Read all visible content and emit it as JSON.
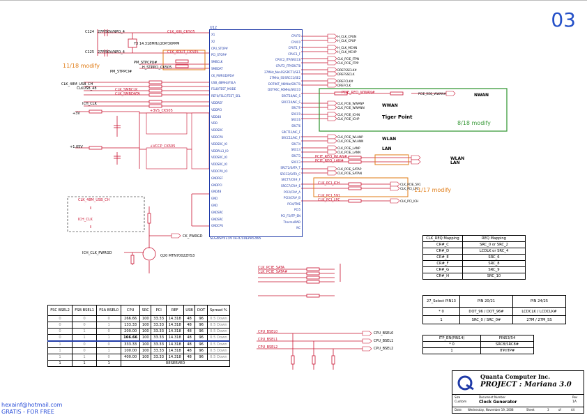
{
  "page": {
    "number": "03"
  },
  "chip": {
    "ref": "U12",
    "part": "SLG8SP513VTR-ICS9LPRS365",
    "left_pins": [
      "X1",
      "X2",
      "CPU_STOP#",
      "PCI_STOP#",
      "SMBCLK",
      "SMBDAT",
      "CK_PWRGD/PD#",
      "USB_48MHz/FSLA",
      "FSLB/TEST_MODE",
      "REF0/FSLC/TEST_SEL",
      "VDDREF",
      "VDDPCI",
      "VDD48",
      "VDD",
      "VDDSRC",
      "VDDCPU",
      "VDDSRC_IO",
      "VDDPLL3_IO",
      "VDDSRC_IO",
      "VDDSRC_IO",
      "VDDCPU_IO",
      "GNDREF",
      "GNDPCI",
      "GND48",
      "GND",
      "GND",
      "GNDSRC",
      "GNDSRC",
      "GNDCPU"
    ],
    "right_pins": [
      "CPUT0",
      "CPUC0",
      "CPUT1_F",
      "CPUC1_F",
      "CPUC2_ITP/SRCC8",
      "CPUT2_ITP/SRCT8",
      "27MHz_NonSS/SRCT1/SE1",
      "27MHz_SS/SRCC1/SE2",
      "DOT96T_96MHz/SRCT0",
      "DOT96C_96MHz/SRCC0",
      "SRCT10/NC_S",
      "SRCC10/NC_S",
      "SRCT9",
      "SRCC9",
      "SRCC6",
      "SRCT6",
      "SRCT11/NC_F",
      "SRCC11/NC_F",
      "SRCT4",
      "SRCC4",
      "SRCT3",
      "SRCC3",
      "SRCT2/SATA_T",
      "SRCC2/SATA_C",
      "SRCT7/CR#_F",
      "SRCC7/CR#_E",
      "PCI2/CR#_A",
      "PCI3/CR#_B",
      "PCI4/TME",
      "PCI5",
      "PCI_F5/ITP_EN",
      "ThermalPAD",
      "NC"
    ]
  },
  "labels": {
    "top_red": "CLK_XIN_CK505",
    "top_red2": "CLK_XOUT_CK505",
    "crystal": "Y3 14.318MHz/20P/30PPM",
    "c124": "C124",
    "c125": "C125",
    "cap_value": "27P/50V/NPO_4",
    "modify_1118": "11/18 modify",
    "modify_818": "8/18 modify",
    "modify_1117": "11/17 modify",
    "pm_stpcpu": "PM_STPCPU#",
    "pm_stppci": "PM_STPPCI#",
    "pm_stppci_r": "H_STPPCI_CK505",
    "clk_smb": "CLK_SMBCLK",
    "clk_smd": "CLK_SMBDATA",
    "vcore_ck505": "+3VS_CK505",
    "vcore_ck505_io": "+VCCP_CK505",
    "clk48": "CLK_48M_USB_CH",
    "clk48_usb": "CLKUSB_48",
    "ich": "ICH_CLK",
    "v3": "+3V",
    "v1": "+1.05V",
    "ck_pwrgd": "CK_PWRGD",
    "clk_en": "ICH_CLK_PWRGD",
    "q20": "Q20 MTN7002ZHS3",
    "tiger_point": "Tiger Point",
    "nwan": "NWAN",
    "wwan": "WWAN",
    "wlan": "WLAN",
    "lan": "LAN",
    "wlan_lan": "WLAN LAN",
    "pcie_req_nwan": "PCIE_REQ_WWAN#",
    "pcie_req_wlan": "PCIE_REQ_WLAN#",
    "pcie_req_lan": "PCIE_REQ_LAN#",
    "clk_pcie_sataa": "CLK_PCIE_SATA",
    "clk_pcie_sata_b": "CLK_PCIE_SATA#",
    "clk_pci_ich": "CLK_PCI_ICH",
    "clk_pci_591": "CLK_PCI_591",
    "clk_pci_lpc": "CLK_PCI_LPC",
    "net_cpu_bsel0": "CPU_BSEL0",
    "net_cpu_bsel1": "CPU_BSEL1",
    "net_cpu_bsel2": "CPU_BSEL2",
    "watermark_email": "hexainf@hotmail.com",
    "watermark_free": "GRATIS - FOR FREE"
  },
  "right_nets": [
    "H_CLK_CPUN",
    "H_CLK_CPUP",
    "H_CLK_MCHN",
    "H_CLK_MCHP",
    "CLK_PCIE_ITPN",
    "CLK_PCIE_ITPP",
    "DREFSSCLK#",
    "DREFSSCLK",
    "DREFCLK#",
    "DREFCLK",
    "PCIE_REQ_WWAN#",
    "CLK_PCIE_WWANP",
    "CLK_PCIE_WWANN",
    "CLK_PCIE_ICHN",
    "CLK_PCIE_ICHP",
    "CLK_PCIE_WLANP",
    "CLK_PCIE_WLANN",
    "CLK_PCIE_LANP",
    "CLK_PCIE_LANN",
    "CLK_PCIE_SATAP",
    "CLK_PCIE_SATAN",
    "CLK_PCIE_591",
    "CLK_PCI_LPC",
    "CLK_PCI_ICH"
  ],
  "clk_req_table": {
    "headers": [
      "CLK_REQ Mapping",
      "REQ Mapping"
    ],
    "rows": [
      [
        "CR#_C",
        "SRC_0 or SRC_2"
      ],
      [
        "CR#_D",
        "LCDLK or SRC_4"
      ],
      [
        "CR#_E",
        "SRC_6"
      ],
      [
        "CR#_F",
        "SRC_8"
      ],
      [
        "CR#_G",
        "SRC_9"
      ],
      [
        "CR#_H",
        "SRC_10"
      ]
    ]
  },
  "select_table": {
    "headers": [
      "27_Select PIN13",
      "PIN 20/21",
      "PIN 24/25"
    ],
    "rows": [
      [
        "*  0",
        "DOT_96 / DOT_96#",
        "LCDCLK / LCDCLK#"
      ],
      [
        "1",
        "SRC_0 / SRC_0#",
        "27M / 27M_SS"
      ]
    ]
  },
  "itp_table": {
    "headers": [
      "ITP_EN(PIN14)",
      "PIN53/54"
    ],
    "rows": [
      [
        "*  0",
        "SRC8/SRC8#"
      ],
      [
        "1",
        "ITP/ITP#"
      ]
    ]
  },
  "fs_table": {
    "headers": [
      "FSC BSEL2",
      "FSB BSEL1",
      "FSA BSEL0",
      "CPU",
      "SRC",
      "PCI",
      "REF",
      "USB",
      "DOT",
      "Spread %"
    ],
    "rows": [
      [
        "0",
        "0",
        "0",
        "266.66",
        "100",
        "33.33",
        "14.318",
        "48",
        "96",
        "0.5 Down"
      ],
      [
        "0",
        "0",
        "1",
        "133.33",
        "100",
        "33.33",
        "14.318",
        "48",
        "96",
        "0.5 Down"
      ],
      [
        "0",
        "1",
        "0",
        "200.00",
        "100",
        "33.33",
        "14.318",
        "48",
        "96",
        "0.5 Down"
      ],
      [
        "0",
        "1",
        "1",
        "166.66",
        "100",
        "33.33",
        "14.318",
        "48",
        "96",
        "0.5 Down"
      ],
      [
        "1",
        "0",
        "0",
        "333.33",
        "100",
        "33.33",
        "14.318",
        "48",
        "96",
        "0.5 Down"
      ],
      [
        "1",
        "0",
        "1",
        "100.00",
        "100",
        "33.33",
        "14.318",
        "48",
        "96",
        "0.5 Down"
      ],
      [
        "1",
        "1",
        "0",
        "400.00",
        "100",
        "33.33",
        "14.318",
        "48",
        "96",
        "0.5 Down"
      ],
      [
        "1",
        "1",
        "1",
        "RESERVED",
        "",
        "",
        "",
        "",
        "",
        ""
      ]
    ]
  },
  "title_block": {
    "company": "Quanta Computer Inc.",
    "project": "PROJECT : Mariana 3.0",
    "size_label": "Size",
    "size": "Custom",
    "doc_label": "Document Number",
    "doc": "Clock Generator",
    "rev_label": "Rev",
    "rev": "1A",
    "date_label": "Date:",
    "date": "Wednesday, November 19, 2008",
    "sheet_label": "Sheet",
    "sheet": "3",
    "of_label": "of",
    "total": "44"
  }
}
